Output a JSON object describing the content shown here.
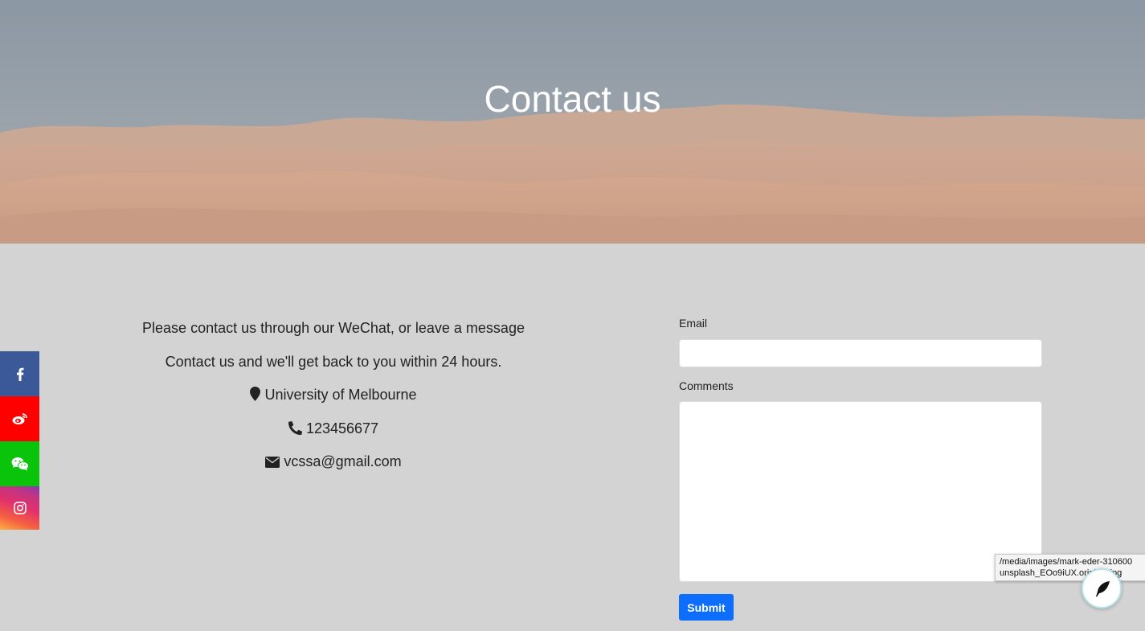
{
  "hero": {
    "title": "Contact us"
  },
  "contact": {
    "intro": "Please contact us through our WeChat, or leave a message",
    "reply_note": "Contact us and we'll get back to you within 24 hours.",
    "location": "University of Melbourne",
    "phone": "123456677",
    "email": "vcssa@gmail.com",
    "icons": [
      "map-marker-icon",
      "phone-icon",
      "envelope-icon"
    ]
  },
  "form": {
    "email_label": "Email",
    "email_value": "",
    "comments_label": "Comments",
    "comments_value": "",
    "submit_label": "Submit"
  },
  "social": {
    "items": [
      {
        "name": "facebook",
        "icon": "facebook-icon",
        "color": "#3b5998"
      },
      {
        "name": "weibo",
        "icon": "weibo-icon",
        "color": "#ff0000"
      },
      {
        "name": "wechat",
        "icon": "wechat-icon",
        "color": "#09c40a"
      },
      {
        "name": "instagram",
        "icon": "instagram-icon",
        "color": "#e1306c"
      }
    ]
  },
  "tooltip": {
    "line1": "/media/images/mark-eder-310600",
    "line2": "unsplash_EOo9iUX.original.jpg"
  },
  "colors": {
    "page_bg": "#d3d3d3",
    "accent": "#0d6efd"
  }
}
